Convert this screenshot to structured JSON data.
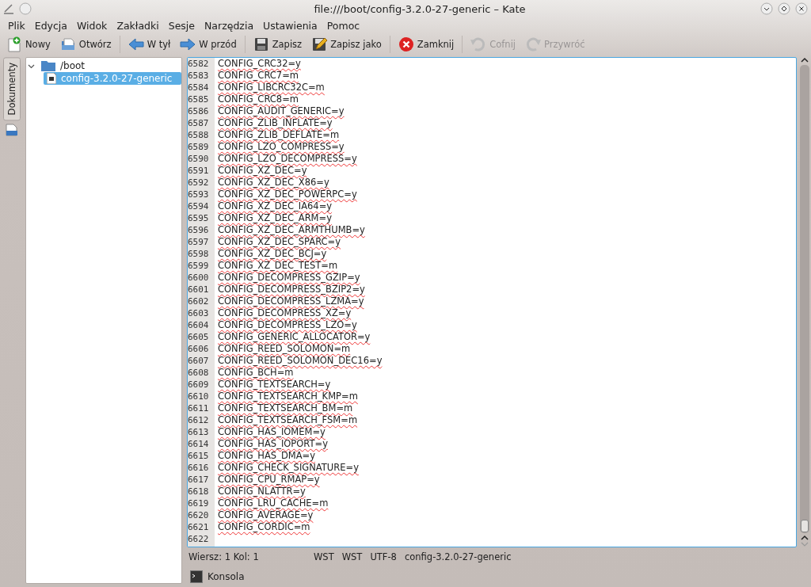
{
  "window": {
    "title": "file:///boot/config-3.2.0-27-generic – Kate"
  },
  "menu": [
    "Plik",
    "Edycja",
    "Widok",
    "Zakładki",
    "Sesje",
    "Narzędzia",
    "Ustawienia",
    "Pomoc"
  ],
  "toolbar": [
    {
      "kind": "new",
      "label": "Nowy",
      "disabled": false
    },
    {
      "kind": "open",
      "label": "Otwórz",
      "disabled": false
    },
    {
      "kind": "separator"
    },
    {
      "kind": "back",
      "label": "W tył",
      "disabled": false
    },
    {
      "kind": "forward",
      "label": "W przód",
      "disabled": false
    },
    {
      "kind": "separator"
    },
    {
      "kind": "save",
      "label": "Zapisz",
      "disabled": false
    },
    {
      "kind": "saveas",
      "label": "Zapisz jako",
      "disabled": false
    },
    {
      "kind": "separator"
    },
    {
      "kind": "close",
      "label": "Zamknij",
      "disabled": false
    },
    {
      "kind": "separator"
    },
    {
      "kind": "undo",
      "label": "Cofnij",
      "disabled": true
    },
    {
      "kind": "redo",
      "label": "Przywróć",
      "disabled": true
    }
  ],
  "side_tab": {
    "label": "Dokumenty",
    "selected": true
  },
  "tree": [
    {
      "label": "/boot",
      "expanded": true,
      "selected": false,
      "children": [
        {
          "label": "config-3.2.0-27-generic",
          "selected": true
        }
      ]
    }
  ],
  "editor": {
    "lines": [
      {
        "number": "6582",
        "text": "CONFIG_CRC32=y"
      },
      {
        "number": "6583",
        "text": "CONFIG_CRC7=m"
      },
      {
        "number": "6584",
        "text": "CONFIG_LIBCRC32C=m"
      },
      {
        "number": "6585",
        "text": "CONFIG_CRC8=m"
      },
      {
        "number": "6586",
        "text": "CONFIG_AUDIT_GENERIC=y"
      },
      {
        "number": "6587",
        "text": "CONFIG_ZLIB_INFLATE=y"
      },
      {
        "number": "6588",
        "text": "CONFIG_ZLIB_DEFLATE=m"
      },
      {
        "number": "6589",
        "text": "CONFIG_LZO_COMPRESS=y"
      },
      {
        "number": "6590",
        "text": "CONFIG_LZO_DECOMPRESS=y"
      },
      {
        "number": "6591",
        "text": "CONFIG_XZ_DEC=y"
      },
      {
        "number": "6592",
        "text": "CONFIG_XZ_DEC_X86=y"
      },
      {
        "number": "6593",
        "text": "CONFIG_XZ_DEC_POWERPC=y"
      },
      {
        "number": "6594",
        "text": "CONFIG_XZ_DEC_IA64=y"
      },
      {
        "number": "6595",
        "text": "CONFIG_XZ_DEC_ARM=y"
      },
      {
        "number": "6596",
        "text": "CONFIG_XZ_DEC_ARMTHUMB=y"
      },
      {
        "number": "6597",
        "text": "CONFIG_XZ_DEC_SPARC=y"
      },
      {
        "number": "6598",
        "text": "CONFIG_XZ_DEC_BCJ=y"
      },
      {
        "number": "6599",
        "text": "CONFIG_XZ_DEC_TEST=m"
      },
      {
        "number": "6600",
        "text": "CONFIG_DECOMPRESS_GZIP=y"
      },
      {
        "number": "6601",
        "text": "CONFIG_DECOMPRESS_BZIP2=y"
      },
      {
        "number": "6602",
        "text": "CONFIG_DECOMPRESS_LZMA=y"
      },
      {
        "number": "6603",
        "text": "CONFIG_DECOMPRESS_XZ=y"
      },
      {
        "number": "6604",
        "text": "CONFIG_DECOMPRESS_LZO=y"
      },
      {
        "number": "6605",
        "text": "CONFIG_GENERIC_ALLOCATOR=y"
      },
      {
        "number": "6606",
        "text": "CONFIG_REED_SOLOMON=m"
      },
      {
        "number": "6607",
        "text": "CONFIG_REED_SOLOMON_DEC16=y"
      },
      {
        "number": "6608",
        "text": "CONFIG_BCH=m"
      },
      {
        "number": "6609",
        "text": "CONFIG_TEXTSEARCH=y"
      },
      {
        "number": "6610",
        "text": "CONFIG_TEXTSEARCH_KMP=m"
      },
      {
        "number": "6611",
        "text": "CONFIG_TEXTSEARCH_BM=m"
      },
      {
        "number": "6612",
        "text": "CONFIG_TEXTSEARCH_FSM=m"
      },
      {
        "number": "6613",
        "text": "CONFIG_HAS_IOMEM=y"
      },
      {
        "number": "6614",
        "text": "CONFIG_HAS_IOPORT=y"
      },
      {
        "number": "6615",
        "text": "CONFIG_HAS_DMA=y"
      },
      {
        "number": "6616",
        "text": "CONFIG_CHECK_SIGNATURE=y"
      },
      {
        "number": "6617",
        "text": "CONFIG_CPU_RMAP=y"
      },
      {
        "number": "6618",
        "text": "CONFIG_NLATTR=y"
      },
      {
        "number": "6619",
        "text": "CONFIG_LRU_CACHE=m"
      },
      {
        "number": "6620",
        "text": "CONFIG_AVERAGE=y"
      },
      {
        "number": "6621",
        "text": "CONFIG_CORDIC=m"
      },
      {
        "number": "6622"
      }
    ]
  },
  "status_bar": {
    "position": "Wiersz: 1 Kol: 1",
    "mode": "WST",
    "mode_2": "WST",
    "encoding": "UTF-8",
    "file": "config-3.2.0-27-generic"
  },
  "bottom_tab": {
    "label": "Konsola",
    "selected": false
  }
}
